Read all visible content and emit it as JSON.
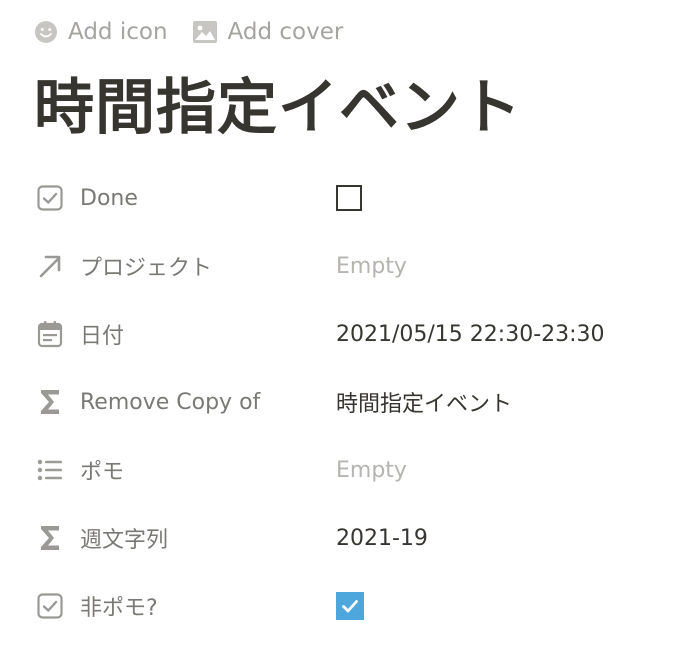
{
  "header": {
    "add_icon_label": "Add icon",
    "add_cover_label": "Add cover"
  },
  "page": {
    "title": "時間指定イベント"
  },
  "properties": [
    {
      "name": "Done",
      "icon": "checkbox-property-icon",
      "type": "checkbox",
      "checked": false
    },
    {
      "name": "プロジェクト",
      "icon": "relation-arrow-icon",
      "type": "relation",
      "value": "Empty"
    },
    {
      "name": "日付",
      "icon": "calendar-icon",
      "type": "date",
      "value": "2021/05/15 22:30-23:30"
    },
    {
      "name": "Remove Copy of",
      "icon": "formula-sigma-icon",
      "type": "formula",
      "value": "時間指定イベント"
    },
    {
      "name": "ポモ",
      "icon": "list-icon",
      "type": "multi-select",
      "value": "Empty"
    },
    {
      "name": "週文字列",
      "icon": "formula-sigma-icon",
      "type": "formula",
      "value": "2021-19"
    },
    {
      "name": "非ポモ?",
      "icon": "checkbox-property-icon",
      "type": "checkbox",
      "checked": true
    }
  ],
  "colors": {
    "text": "#37352f",
    "muted": "#a5a4a0",
    "property_label": "#7a7975",
    "empty": "#b5b4b0",
    "checkbox_checked": "#4ea7dc"
  }
}
